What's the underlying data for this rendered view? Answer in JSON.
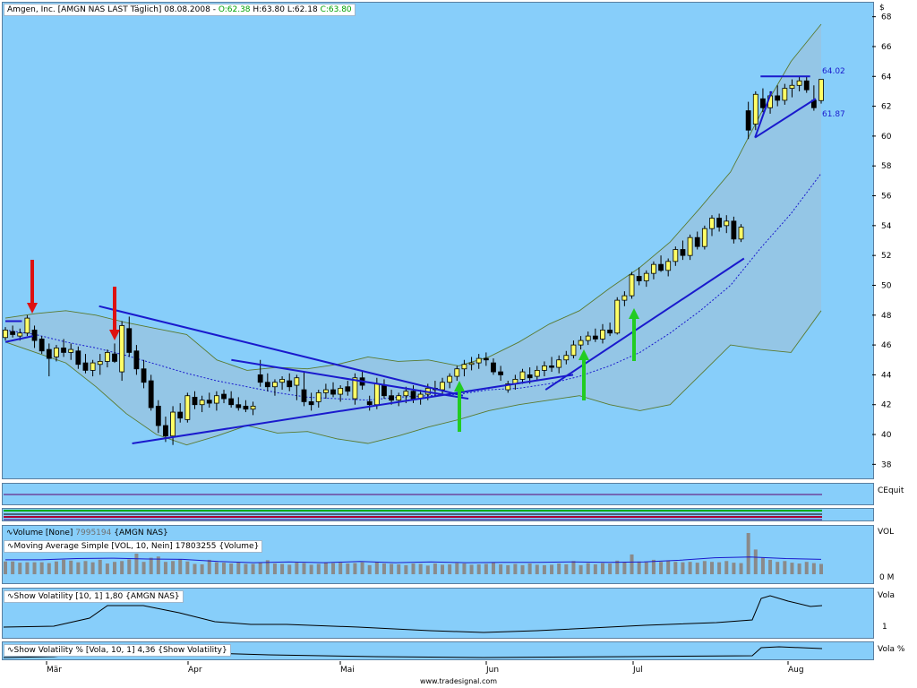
{
  "main": {
    "legend": {
      "name": "Amgen, Inc.",
      "symbol": "[AMGN NAS LAST Täglich]",
      "date": "08.08.2008",
      "open": "O:62.38",
      "high": "H:63.80",
      "low": "L:62.18",
      "close": "C:63.80"
    },
    "currency": "$",
    "annotations": {
      "upper": "64.02",
      "lower": "61.87"
    }
  },
  "panes": {
    "cequity": {
      "label": "CEquit"
    },
    "volume": {
      "label": "VOL",
      "tick": "0 M",
      "legend1": "Volume [None]",
      "legend1_value": "7995194",
      "legend1_suffix": "{AMGN NAS}",
      "legend2": "Moving Average Simple [VOL, 10, Nein]",
      "legend2_value": "17803255",
      "legend2_suffix": "{Volume}"
    },
    "vola": {
      "label": "Vola",
      "tick": "1",
      "legend": "Show Volatility [10, 1] 1,80 {AMGN NAS}"
    },
    "volapct": {
      "label": "Vola %",
      "legend": "Show Volatility % [Vola, 10, 1] 4,36 {Show Volatility}"
    }
  },
  "footer": "www.tradesignal.com",
  "colors": {
    "background": "#87CEFA",
    "band_fill": "#9fbfd6",
    "trendline": "#1a1acd",
    "up_candle": "#ffff66",
    "down_candle": "#000000",
    "buy_arrow": "#22cc22",
    "sell_arrow": "#dd1111"
  },
  "chart_data": [
    {
      "type": "candlestick",
      "title": "Amgen, Inc. [AMGN NAS LAST Täglich]",
      "ylabel": "$",
      "ylim": [
        37,
        69
      ],
      "y_ticks": [
        38,
        40,
        42,
        44,
        46,
        48,
        50,
        52,
        54,
        56,
        58,
        60,
        62,
        64,
        66,
        68
      ],
      "x_tick_labels": [
        "Mär",
        "Apr",
        "Mai",
        "Jun",
        "Jul",
        "Aug"
      ],
      "ohlc": [
        [
          46.5,
          47.2,
          46.3,
          47.0
        ],
        [
          46.9,
          47.3,
          46.5,
          46.7
        ],
        [
          46.6,
          47.1,
          46.3,
          46.8
        ],
        [
          46.8,
          48.0,
          46.6,
          47.8
        ],
        [
          47.0,
          47.3,
          45.8,
          46.3
        ],
        [
          46.4,
          46.6,
          45.4,
          45.6
        ],
        [
          45.7,
          46.1,
          43.9,
          45.1
        ],
        [
          45.2,
          46.0,
          44.9,
          45.8
        ],
        [
          45.8,
          46.4,
          45.2,
          45.5
        ],
        [
          45.5,
          46.1,
          45.0,
          45.7
        ],
        [
          45.6,
          45.9,
          44.4,
          44.7
        ],
        [
          44.8,
          45.4,
          44.1,
          44.3
        ],
        [
          44.3,
          45.0,
          43.9,
          44.8
        ],
        [
          44.7,
          45.4,
          44.0,
          44.9
        ],
        [
          44.9,
          45.7,
          44.5,
          45.5
        ],
        [
          45.4,
          46.1,
          44.8,
          44.9
        ],
        [
          44.2,
          47.6,
          43.6,
          47.3
        ],
        [
          47.1,
          47.9,
          45.2,
          45.5
        ],
        [
          45.6,
          46.0,
          44.0,
          44.4
        ],
        [
          44.4,
          45.0,
          43.1,
          43.5
        ],
        [
          43.6,
          44.0,
          41.6,
          41.8
        ],
        [
          41.9,
          42.3,
          40.1,
          40.6
        ],
        [
          40.6,
          41.2,
          39.5,
          39.9
        ],
        [
          39.9,
          41.9,
          39.3,
          41.5
        ],
        [
          41.5,
          42.1,
          40.8,
          41.1
        ],
        [
          41.0,
          42.8,
          40.8,
          42.6
        ],
        [
          42.5,
          42.9,
          41.7,
          42.0
        ],
        [
          42.0,
          42.6,
          41.5,
          42.3
        ],
        [
          42.3,
          42.8,
          41.8,
          42.1
        ],
        [
          42.1,
          42.9,
          41.6,
          42.6
        ],
        [
          42.7,
          43.0,
          42.1,
          42.4
        ],
        [
          42.4,
          42.9,
          41.8,
          42.0
        ],
        [
          42.0,
          42.5,
          41.6,
          41.8
        ],
        [
          41.9,
          42.3,
          41.5,
          41.7
        ],
        [
          41.7,
          42.2,
          41.3,
          41.9
        ],
        [
          44.0,
          45.0,
          43.2,
          43.5
        ],
        [
          43.5,
          44.1,
          42.9,
          43.2
        ],
        [
          43.2,
          43.7,
          42.6,
          43.5
        ],
        [
          43.5,
          43.9,
          43.0,
          43.7
        ],
        [
          43.6,
          44.1,
          42.9,
          43.2
        ],
        [
          43.3,
          44.0,
          42.3,
          43.8
        ],
        [
          43.0,
          44.2,
          41.9,
          42.2
        ],
        [
          42.2,
          42.8,
          41.6,
          42.0
        ],
        [
          42.2,
          43.0,
          41.8,
          42.8
        ],
        [
          42.8,
          43.4,
          42.4,
          43.0
        ],
        [
          43.0,
          43.5,
          42.5,
          42.7
        ],
        [
          42.7,
          43.3,
          42.2,
          43.1
        ],
        [
          43.2,
          43.6,
          42.6,
          42.9
        ],
        [
          42.4,
          44.1,
          42.0,
          43.8
        ],
        [
          43.8,
          44.2,
          43.0,
          43.3
        ],
        [
          42.2,
          42.6,
          41.6,
          42.0
        ],
        [
          42.0,
          43.8,
          41.7,
          43.4
        ],
        [
          43.3,
          43.7,
          42.4,
          42.6
        ],
        [
          42.6,
          43.0,
          42.0,
          42.3
        ],
        [
          42.3,
          42.8,
          41.9,
          42.6
        ],
        [
          42.6,
          43.2,
          42.1,
          42.9
        ],
        [
          42.9,
          43.3,
          42.1,
          42.4
        ],
        [
          42.4,
          43.0,
          42.0,
          42.7
        ],
        [
          42.7,
          43.4,
          42.3,
          43.1
        ],
        [
          43.1,
          43.6,
          42.6,
          43.0
        ],
        [
          43.0,
          43.8,
          42.7,
          43.5
        ],
        [
          43.5,
          44.1,
          43.1,
          43.9
        ],
        [
          43.9,
          44.6,
          43.6,
          44.4
        ],
        [
          44.4,
          45.0,
          43.9,
          44.7
        ],
        [
          44.7,
          45.2,
          44.3,
          44.8
        ],
        [
          44.8,
          45.4,
          44.4,
          45.1
        ],
        [
          45.1,
          45.5,
          44.6,
          45.0
        ],
        [
          44.8,
          45.1,
          44.0,
          44.2
        ],
        [
          44.2,
          44.6,
          43.6,
          44.0
        ],
        [
          43.0,
          43.6,
          42.8,
          43.4
        ],
        [
          43.4,
          44.0,
          43.0,
          43.7
        ],
        [
          43.7,
          44.4,
          43.4,
          44.2
        ],
        [
          44.0,
          44.5,
          43.4,
          43.8
        ],
        [
          43.9,
          44.6,
          43.6,
          44.3
        ],
        [
          44.3,
          44.9,
          43.9,
          44.6
        ],
        [
          44.6,
          45.2,
          44.2,
          44.5
        ],
        [
          44.5,
          45.3,
          44.1,
          45.0
        ],
        [
          45.0,
          45.6,
          44.7,
          45.3
        ],
        [
          45.3,
          46.3,
          45.1,
          46.0
        ],
        [
          46.0,
          46.6,
          45.7,
          46.3
        ],
        [
          46.3,
          46.9,
          46.0,
          46.6
        ],
        [
          46.6,
          47.1,
          46.2,
          46.4
        ],
        [
          46.4,
          47.4,
          46.1,
          47.0
        ],
        [
          47.0,
          47.5,
          46.6,
          46.8
        ],
        [
          46.8,
          49.2,
          46.7,
          49.0
        ],
        [
          49.0,
          49.6,
          48.6,
          49.3
        ],
        [
          49.3,
          50.9,
          49.1,
          50.7
        ],
        [
          50.6,
          51.2,
          50.0,
          50.3
        ],
        [
          50.3,
          51.0,
          49.9,
          50.8
        ],
        [
          50.8,
          51.6,
          50.4,
          51.4
        ],
        [
          51.4,
          52.0,
          50.9,
          51.0
        ],
        [
          51.0,
          51.8,
          50.6,
          51.6
        ],
        [
          51.6,
          52.6,
          51.3,
          52.4
        ],
        [
          52.4,
          53.0,
          51.7,
          52.0
        ],
        [
          52.0,
          53.4,
          51.7,
          53.2
        ],
        [
          53.2,
          53.6,
          52.4,
          52.6
        ],
        [
          52.6,
          54.0,
          52.4,
          53.8
        ],
        [
          53.8,
          54.7,
          53.3,
          54.5
        ],
        [
          54.5,
          54.8,
          53.6,
          53.9
        ],
        [
          54.0,
          54.7,
          53.5,
          54.3
        ],
        [
          54.3,
          54.6,
          52.8,
          53.1
        ],
        [
          53.1,
          54.1,
          52.9,
          53.9
        ],
        [
          61.7,
          62.3,
          59.8,
          60.4
        ],
        [
          60.8,
          63.0,
          60.4,
          62.8
        ],
        [
          62.5,
          63.2,
          61.6,
          61.9
        ],
        [
          61.9,
          63.0,
          61.5,
          62.7
        ],
        [
          62.7,
          63.4,
          62.0,
          62.4
        ],
        [
          62.4,
          63.5,
          62.1,
          63.2
        ],
        [
          63.2,
          63.8,
          62.6,
          63.4
        ],
        [
          63.4,
          64.0,
          63.0,
          63.7
        ],
        [
          63.7,
          64.0,
          62.9,
          63.1
        ],
        [
          62.4,
          63.4,
          61.7,
          61.9
        ],
        [
          62.38,
          63.8,
          62.18,
          63.8
        ]
      ],
      "bollinger": {
        "upper": [
          47.8,
          48.1,
          48.3,
          48.0,
          47.5,
          47.1,
          46.7,
          45.0,
          44.3,
          44.5,
          44.4,
          44.7,
          45.2,
          44.9,
          45.0,
          44.6,
          45.2,
          46.2,
          47.4,
          48.3,
          49.8,
          51.2,
          52.9,
          55.2,
          57.6,
          61.5,
          65.0,
          67.5
        ],
        "middle": [
          47.0,
          46.7,
          46.2,
          45.8,
          45.3,
          44.7,
          44.1,
          43.6,
          43.2,
          42.8,
          42.5,
          42.4,
          42.3,
          42.5,
          42.6,
          42.7,
          43.0,
          43.1,
          43.4,
          43.9,
          44.6,
          45.5,
          46.8,
          48.3,
          50.0,
          52.5,
          54.8,
          57.5
        ],
        "lower": [
          46.2,
          45.5,
          44.8,
          43.2,
          41.4,
          40.0,
          39.3,
          39.9,
          40.6,
          40.1,
          40.2,
          39.7,
          39.4,
          39.9,
          40.5,
          41.0,
          41.6,
          42.0,
          42.3,
          42.6,
          42.0,
          41.6,
          42.0,
          44.0,
          46.0,
          45.7,
          45.5,
          48.3
        ]
      },
      "volume": [
        0.31,
        0.31,
        0.28,
        0.29,
        0.29,
        0.29,
        0.27,
        0.31,
        0.35,
        0.33,
        0.29,
        0.32,
        0.29,
        0.35,
        0.26,
        0.3,
        0.32,
        0.36,
        0.5,
        0.3,
        0.4,
        0.43,
        0.3,
        0.32,
        0.37,
        0.31,
        0.25,
        0.24,
        0.35,
        0.29,
        0.28,
        0.26,
        0.29,
        0.25,
        0.25,
        0.28,
        0.34,
        0.26,
        0.25,
        0.23,
        0.28,
        0.27,
        0.23,
        0.25,
        0.29,
        0.27,
        0.28,
        0.26,
        0.27,
        0.29,
        0.22,
        0.3,
        0.26,
        0.25,
        0.24,
        0.22,
        0.26,
        0.25,
        0.21,
        0.26,
        0.23,
        0.24,
        0.27,
        0.26,
        0.23,
        0.24,
        0.25,
        0.28,
        0.24,
        0.22,
        0.25,
        0.22,
        0.26,
        0.23,
        0.22,
        0.23,
        0.26,
        0.24,
        0.32,
        0.22,
        0.27,
        0.24,
        0.27,
        0.26,
        0.33,
        0.29,
        0.48,
        0.31,
        0.29,
        0.35,
        0.3,
        0.33,
        0.3,
        0.29,
        0.3,
        0.28,
        0.32,
        0.3,
        0.29,
        0.32,
        0.28,
        0.27,
        1.0,
        0.6,
        0.4,
        0.35,
        0.3,
        0.32,
        0.28,
        0.26,
        0.3,
        0.27,
        0.25
      ],
      "volume_ma": [
        0.35,
        0.35,
        0.38,
        0.39,
        0.37,
        0.36,
        0.31,
        0.28,
        0.3,
        0.28,
        0.31,
        0.28,
        0.3,
        0.28,
        0.29,
        0.29,
        0.3,
        0.29,
        0.3,
        0.34,
        0.4,
        0.42,
        0.38,
        0.36
      ]
    }
  ]
}
